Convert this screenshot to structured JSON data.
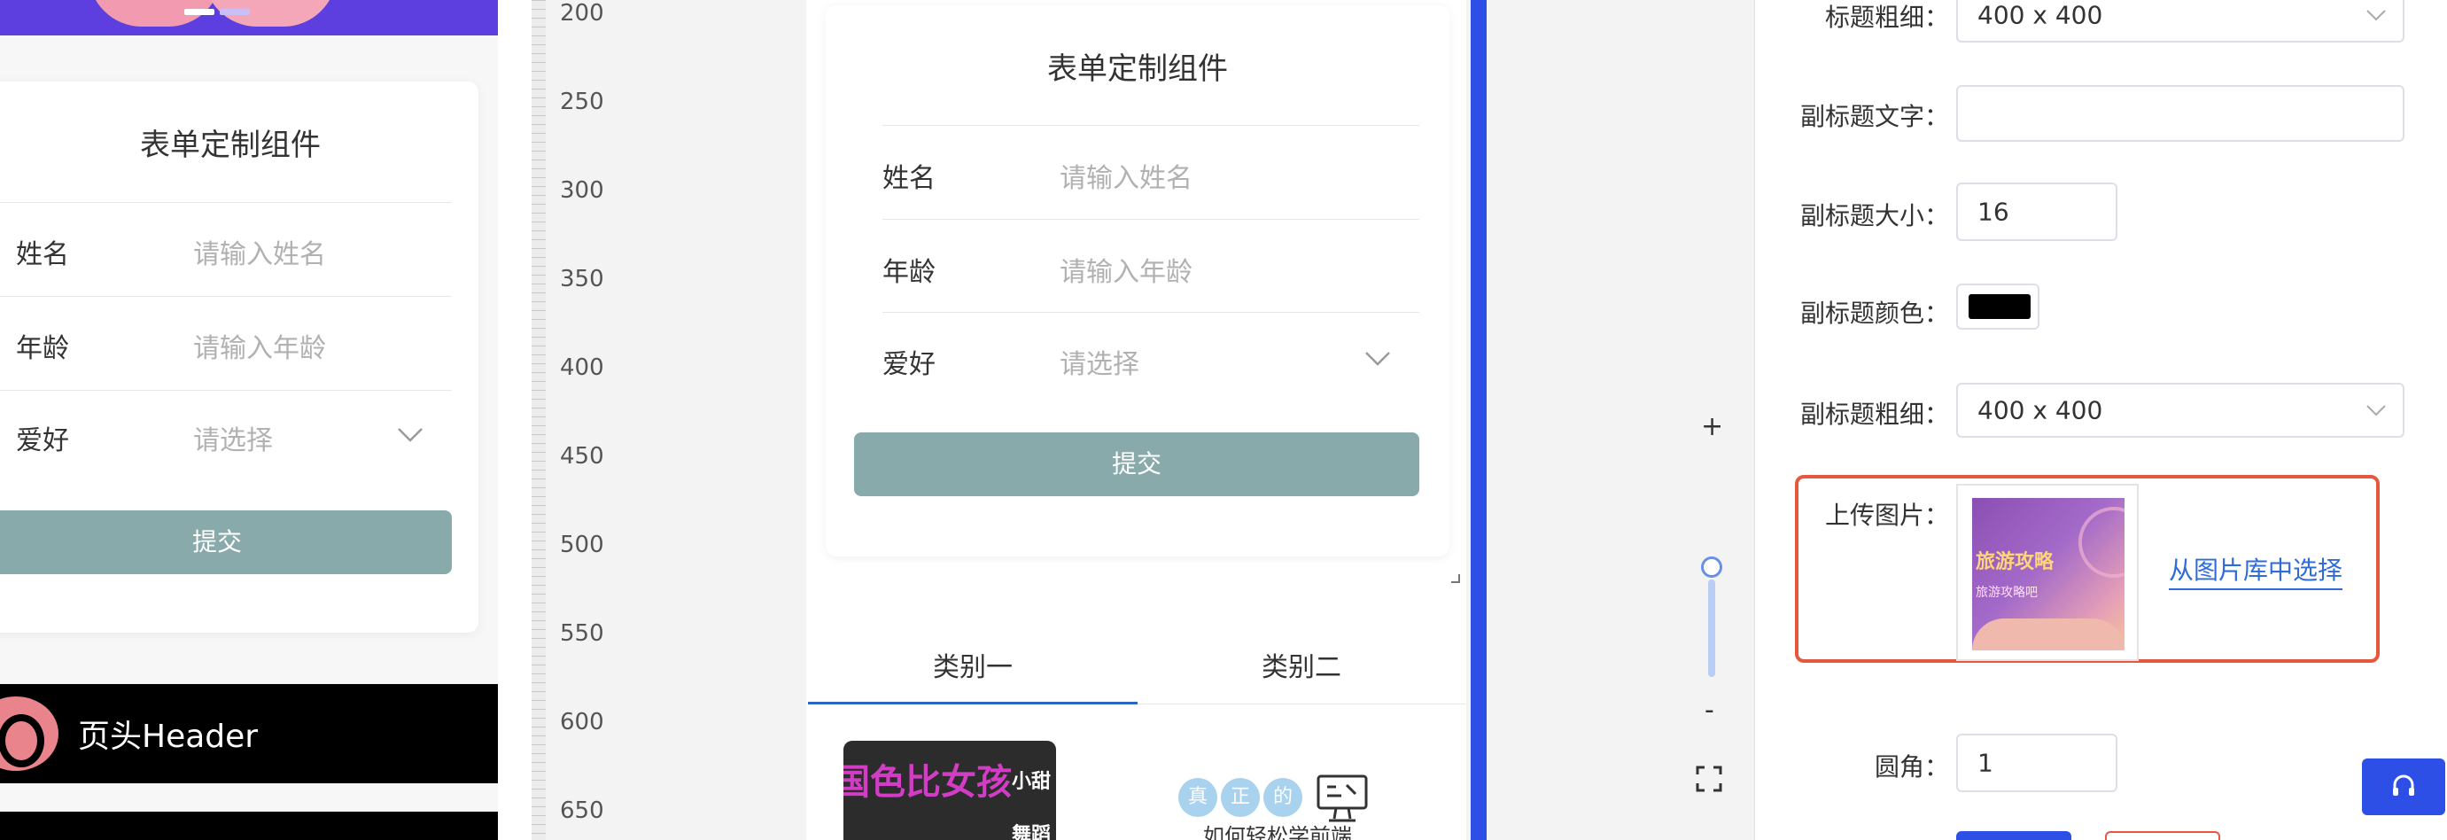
{
  "left_preview": {
    "form": {
      "title": "表单定制组件",
      "rows": [
        {
          "label": "姓名",
          "placeholder": "请输入姓名"
        },
        {
          "label": "年龄",
          "placeholder": "请输入年龄"
        },
        {
          "label": "爱好",
          "placeholder": "请选择"
        }
      ],
      "submit_label": "提交"
    },
    "header_component": {
      "label": "页头Header"
    }
  },
  "canvas": {
    "ruler_ticks": [
      "200",
      "250",
      "300",
      "350",
      "400",
      "450",
      "500",
      "550",
      "600",
      "650"
    ],
    "form": {
      "title": "表单定制组件",
      "rows": [
        {
          "label": "姓名",
          "placeholder": "请输入姓名"
        },
        {
          "label": "年龄",
          "placeholder": "请输入年龄"
        },
        {
          "label": "爱好",
          "placeholder": "请选择"
        }
      ],
      "submit_label": "提交"
    },
    "tabs": [
      {
        "label": "类别一",
        "active": true
      },
      {
        "label": "类别二",
        "active": false
      }
    ],
    "cards": [
      {
        "image_text": [
          "小甜",
          "舞蹈"
        ]
      },
      {
        "bubbles": [
          "真",
          "正",
          "的"
        ],
        "caption": "如何轻松学前端"
      }
    ],
    "zoom": {
      "plus": "+",
      "minus": "-"
    }
  },
  "properties": {
    "title_weight": {
      "label": "标题粗细：",
      "value": "400 x 400"
    },
    "subtitle_text": {
      "label": "副标题文字：",
      "value": ""
    },
    "subtitle_size": {
      "label": "副标题大小：",
      "value": "16"
    },
    "subtitle_color": {
      "label": "副标题颜色：",
      "value": "#000000"
    },
    "subtitle_weight": {
      "label": "副标题粗细：",
      "value": "400 x 400"
    },
    "upload": {
      "label": "上传图片：",
      "link": "从图片库中选择",
      "image_title": "旅游攻略",
      "image_subtitle": "旅游攻略吧"
    },
    "radius": {
      "label": "圆角：",
      "value": "1"
    }
  },
  "colors": {
    "accent_blue": "#2d4fe6",
    "submit_green": "#89aaaa",
    "highlight_red": "#e5573f",
    "link_blue": "#2f6bdb"
  }
}
